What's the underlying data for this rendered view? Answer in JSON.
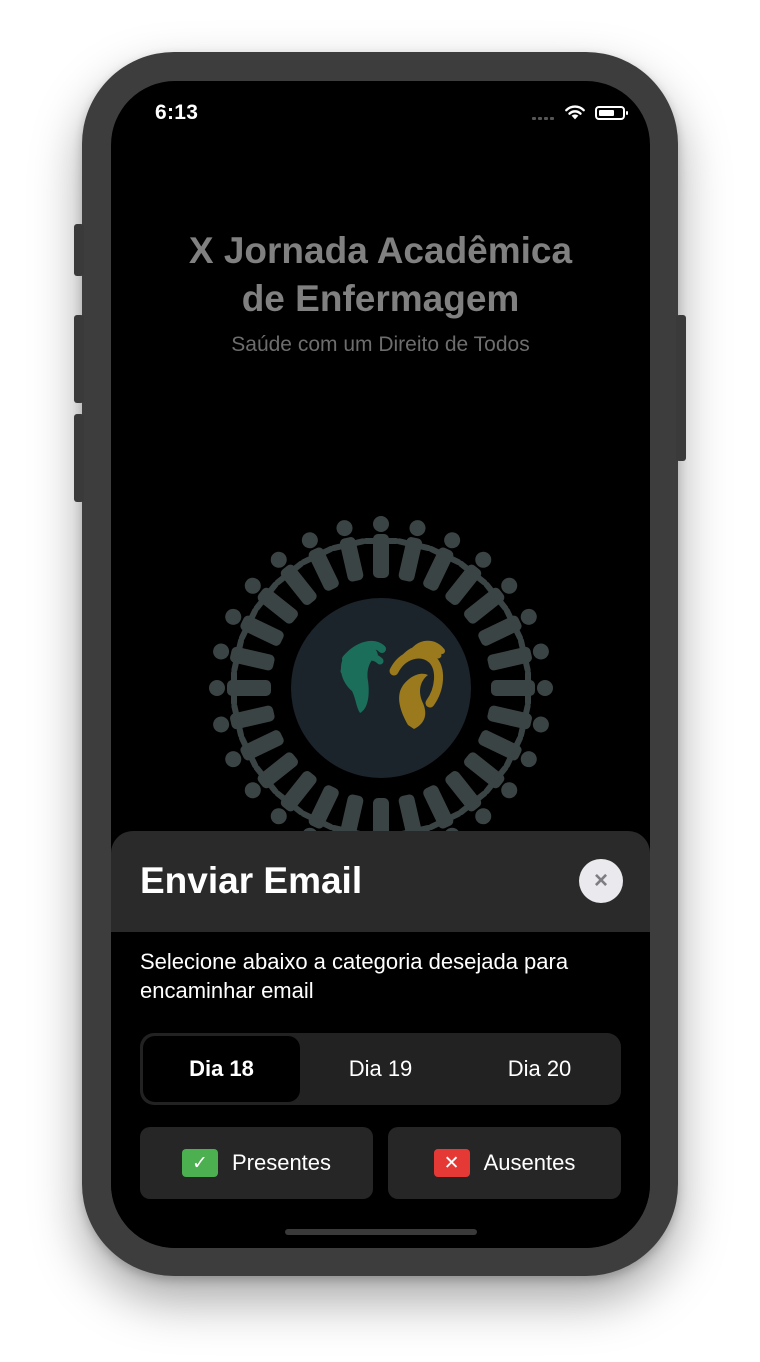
{
  "status_bar": {
    "time": "6:13"
  },
  "header": {
    "title_line1": "X Jornada Acadêmica",
    "title_line2": "de Enfermagem",
    "subtitle": "Saúde com um Direito de Todos"
  },
  "sheet": {
    "title": "Enviar Email",
    "close_symbol": "×",
    "instruction": "Selecione abaixo a categoria desejada para encaminhar email",
    "days": [
      {
        "label": "Dia 18",
        "selected": true
      },
      {
        "label": "Dia 19",
        "selected": false
      },
      {
        "label": "Dia 20",
        "selected": false
      }
    ],
    "present_label": "Presentes",
    "present_symbol": "✓",
    "absent_label": "Ausentes",
    "absent_symbol": "✕"
  },
  "colors": {
    "present_badge": "#4caf50",
    "absent_badge": "#e53935",
    "logo_ring": "#3b4445",
    "logo_center": "#1c242b",
    "hand_left": "#1b6e5a",
    "hand_right": "#9b7a1e"
  },
  "icons": [
    "wifi-icon",
    "battery-icon",
    "close-icon",
    "checkmark-icon",
    "x-icon"
  ]
}
